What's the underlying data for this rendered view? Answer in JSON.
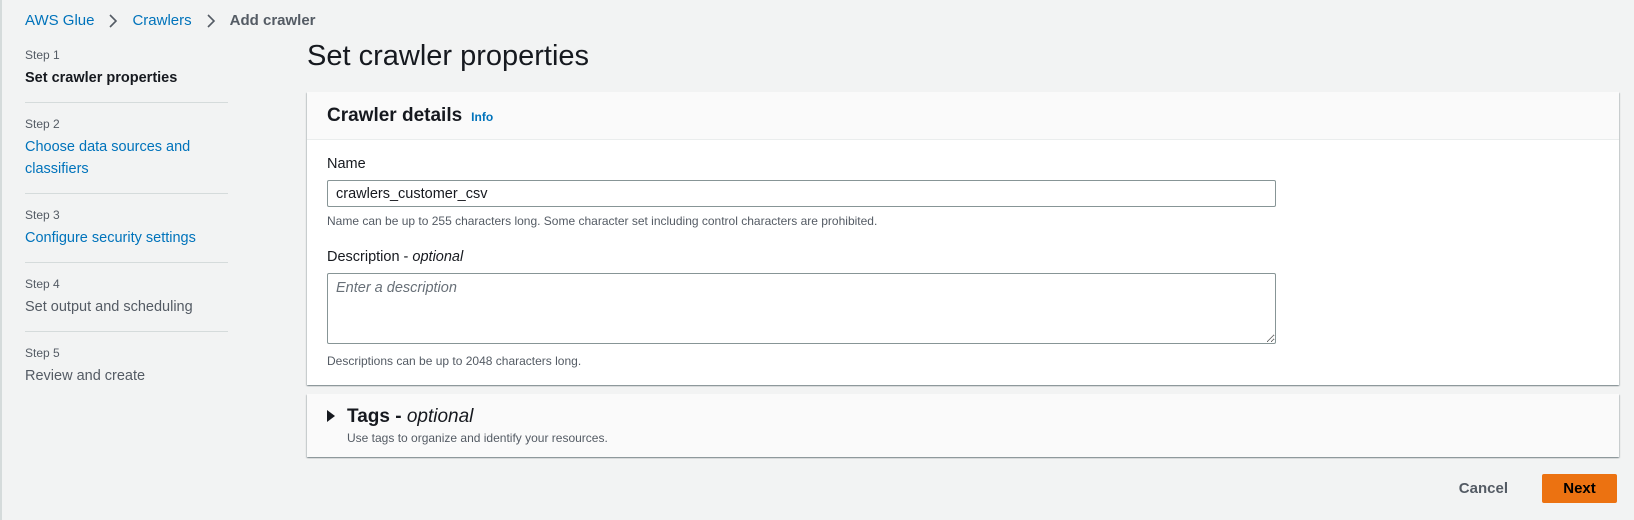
{
  "breadcrumb": {
    "items": [
      {
        "label": "AWS Glue"
      },
      {
        "label": "Crawlers"
      },
      {
        "label": "Add crawler"
      }
    ]
  },
  "steps": [
    {
      "number": "Step 1",
      "title": "Set crawler properties",
      "state": "active"
    },
    {
      "number": "Step 2",
      "title": "Choose data sources and classifiers",
      "state": "link"
    },
    {
      "number": "Step 3",
      "title": "Configure security settings",
      "state": "link"
    },
    {
      "number": "Step 4",
      "title": "Set output and scheduling",
      "state": "disabled"
    },
    {
      "number": "Step 5",
      "title": "Review and create",
      "state": "disabled"
    }
  ],
  "page_title": "Set crawler properties",
  "crawler_details": {
    "title": "Crawler details",
    "info_label": "Info",
    "name_label": "Name",
    "name_value": "crawlers_customer_csv",
    "name_constraint": "Name can be up to 255 characters long. Some character set including control characters are prohibited.",
    "description_label": "Description - ",
    "description_optional": "optional",
    "description_placeholder": "Enter a description",
    "description_constraint": "Descriptions can be up to 2048 characters long."
  },
  "tags": {
    "title": "Tags - ",
    "optional": "optional",
    "description": "Use tags to organize and identify your resources."
  },
  "actions": {
    "cancel_label": "Cancel",
    "next_label": "Next"
  },
  "colors": {
    "link": "#0073bb",
    "primary_button": "#ec7211",
    "background": "#f2f3f3"
  }
}
